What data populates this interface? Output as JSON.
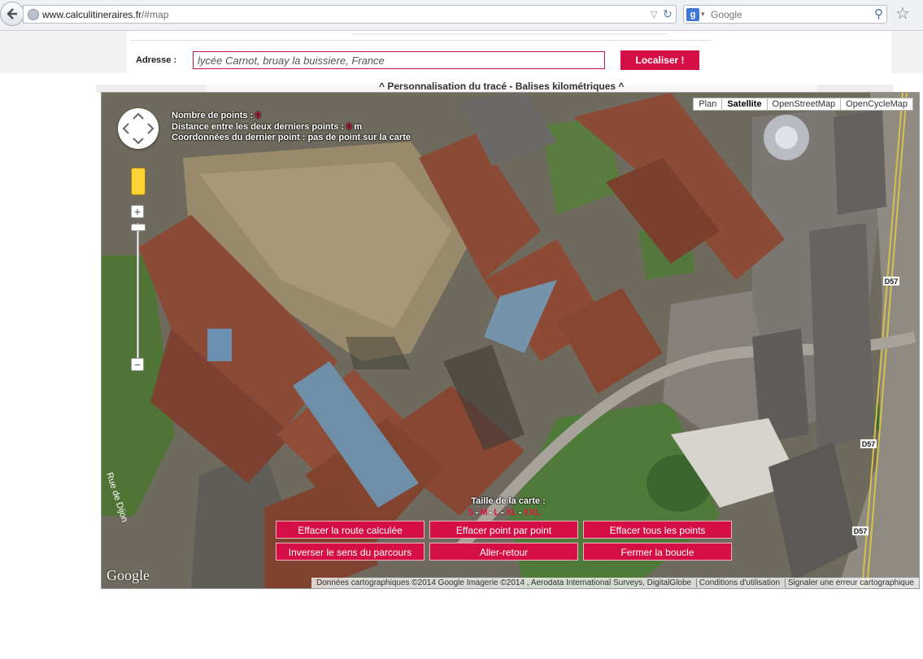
{
  "browser": {
    "url_domain": "www.calculitineraires.fr",
    "url_path": "/#map",
    "search_engine_placeholder": "Google"
  },
  "form": {
    "address_label": "Adresse :",
    "address_value": "lycée Carnot, bruay la buissiere, France",
    "locate_button": "Localiser !"
  },
  "section_toggle": "^ Personnalisation du tracé - Balises kilométriques ^",
  "map": {
    "info": {
      "points_label": "Nombre de points :",
      "points_value": "0",
      "distance_label": "Distance entre les deux derniers points :",
      "distance_value": "0",
      "distance_unit": "m",
      "coords_label": "Coordonnées du dernier point : pas de point sur la carte"
    },
    "map_types": [
      "Plan",
      "Satellite",
      "OpenStreetMap",
      "OpenCycleMap"
    ],
    "active_map_type": "Satellite",
    "zoom_in": "+",
    "zoom_out": "−",
    "size_label": "Taille de la carte :",
    "sizes": [
      "S",
      "M",
      "L",
      "XL",
      "XXL"
    ],
    "buttons": {
      "clear_route": "Effacer la route calculée",
      "clear_point": "Effacer point par point",
      "clear_all": "Effacer tous les points",
      "reverse": "Inverser le sens du parcours",
      "round_trip": "Aller-retour",
      "close_loop": "Fermer la boucle"
    },
    "labels": {
      "road_d57": "D57",
      "street": "Rue de Dijon"
    },
    "google_logo": "Google",
    "attribution": "Données cartographiques ©2014 Google Imagerie ©2014 , Aerodata International Surveys, DigitalGlobe",
    "terms": "Conditions d'utilisation",
    "report": "Signaler une erreur cartographique"
  },
  "colors": {
    "accent": "#d50f45",
    "roof": "#8b4a36",
    "grass": "#4f7436"
  }
}
